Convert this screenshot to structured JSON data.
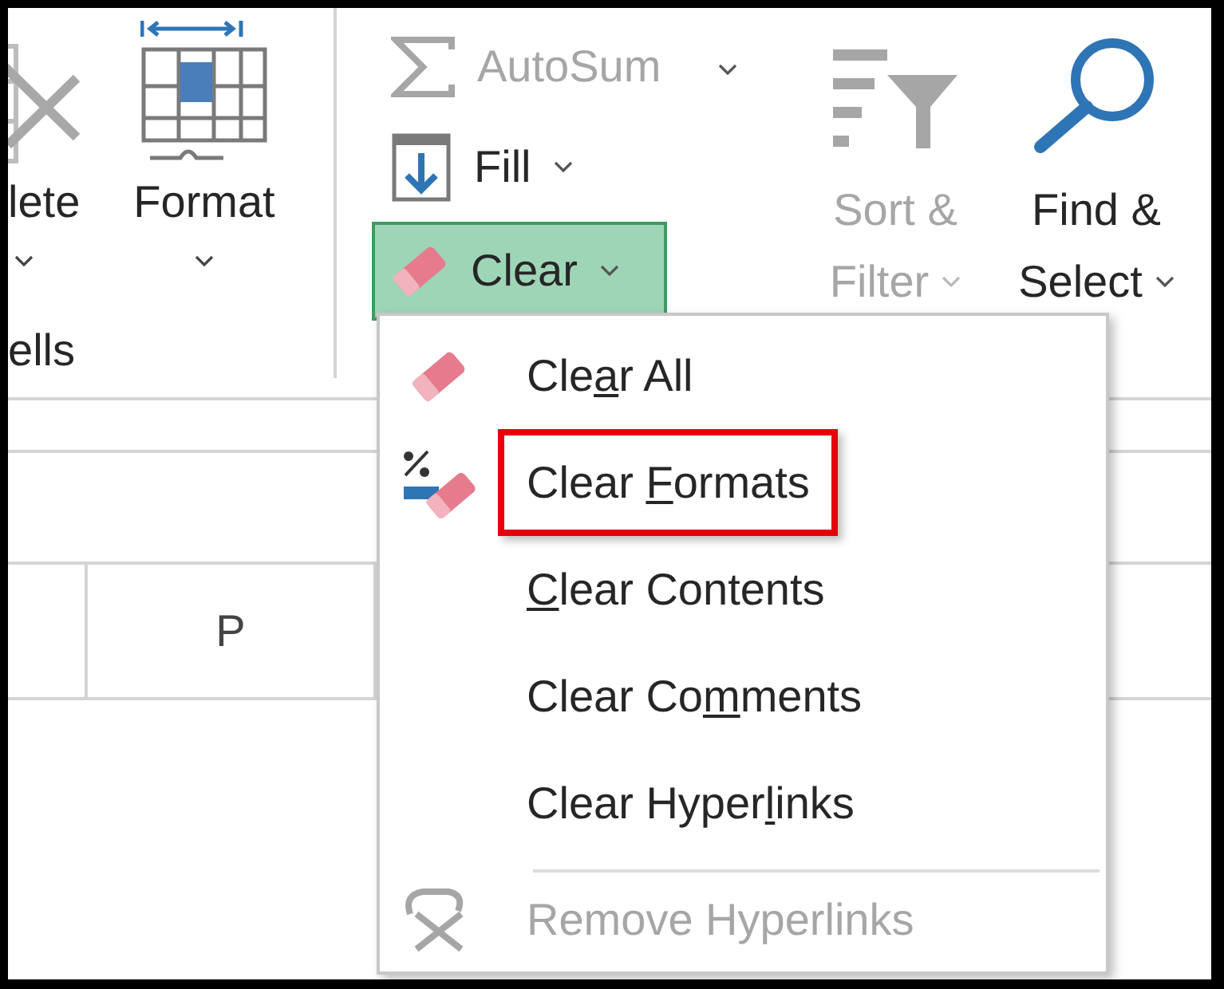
{
  "ribbon": {
    "cells_group": {
      "label": "ells",
      "buttons": [
        {
          "kind": "delete",
          "label": "lete"
        },
        {
          "kind": "format",
          "label": "Format"
        }
      ]
    },
    "editing_group": {
      "small_buttons": [
        {
          "kind": "autosum",
          "label": "AutoSum",
          "disabled": true,
          "selected": false
        },
        {
          "kind": "fill",
          "label": "Fill",
          "disabled": false,
          "selected": false
        },
        {
          "kind": "clear",
          "label": "Clear",
          "disabled": false,
          "selected": true
        }
      ],
      "large_buttons": [
        {
          "kind": "sort",
          "label_lines": [
            "Sort &",
            "Filter"
          ],
          "disabled": true
        },
        {
          "kind": "find",
          "label_lines": [
            "Find &",
            "Select"
          ],
          "disabled": false
        }
      ]
    }
  },
  "sheet": {
    "column_headers": [
      "P"
    ]
  },
  "clear_menu": {
    "items": [
      {
        "kind": "eraser",
        "label_parts": {
          "before": "Cle",
          "key": "a",
          "after": "r All"
        },
        "disabled": false,
        "highlighted": false,
        "separator_before": false
      },
      {
        "kind": "formats",
        "label_parts": {
          "before": "Clear ",
          "key": "F",
          "after": "ormats"
        },
        "disabled": false,
        "highlighted": true,
        "separator_before": false
      },
      {
        "kind": "plain",
        "label_parts": {
          "key": "C",
          "after": "lear Contents"
        },
        "disabled": false,
        "highlighted": false,
        "separator_before": false
      },
      {
        "kind": "plain",
        "label_parts": {
          "before": "Clear Co",
          "key": "m",
          "after": "ments"
        },
        "disabled": false,
        "highlighted": false,
        "separator_before": false
      },
      {
        "kind": "plain",
        "label_parts": {
          "before": "Clear Hyper",
          "key": "l",
          "after": "inks"
        },
        "disabled": false,
        "highlighted": false,
        "separator_before": false
      },
      {
        "kind": "unlink",
        "label_parts": {
          "before": "Remove Hyperlinks"
        },
        "disabled": true,
        "highlighted": false,
        "separator_before": true
      }
    ]
  }
}
